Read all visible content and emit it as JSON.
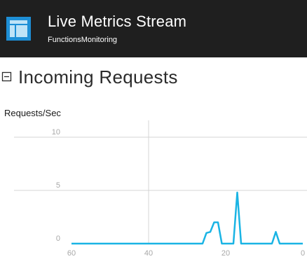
{
  "header": {
    "title": "Live Metrics Stream",
    "subtitle": "FunctionsMonitoring",
    "icon": "dashboard-layout-icon",
    "background": "#1f1f1f",
    "icon_color": "#1e8fd6"
  },
  "section": {
    "title": "Incoming Requests",
    "collapse_icon": "collapse-minus-icon"
  },
  "chart_data": {
    "type": "line",
    "ylabel": "Requests/Sec",
    "xlim": [
      60,
      0
    ],
    "ylim": [
      0,
      10
    ],
    "x_ticks": [
      "60",
      "40",
      "20",
      "0"
    ],
    "y_ticks": [
      "10",
      "5",
      "0"
    ],
    "grid": true,
    "color": "#1ab4e4",
    "series": [
      {
        "x": [
          60,
          26,
          25,
          24,
          23,
          22,
          21,
          20,
          19,
          18,
          17,
          16,
          15,
          14,
          13,
          12,
          11,
          10,
          9,
          8,
          7,
          6,
          5,
          4,
          3,
          2,
          1,
          0
        ],
        "y": [
          0,
          0,
          1.0,
          1.1,
          2.0,
          2.0,
          0,
          0,
          0,
          0,
          4.8,
          0,
          0,
          0,
          0,
          0,
          0,
          0,
          0,
          0,
          1.1,
          0,
          0,
          0,
          0,
          0,
          0,
          0
        ]
      }
    ]
  }
}
